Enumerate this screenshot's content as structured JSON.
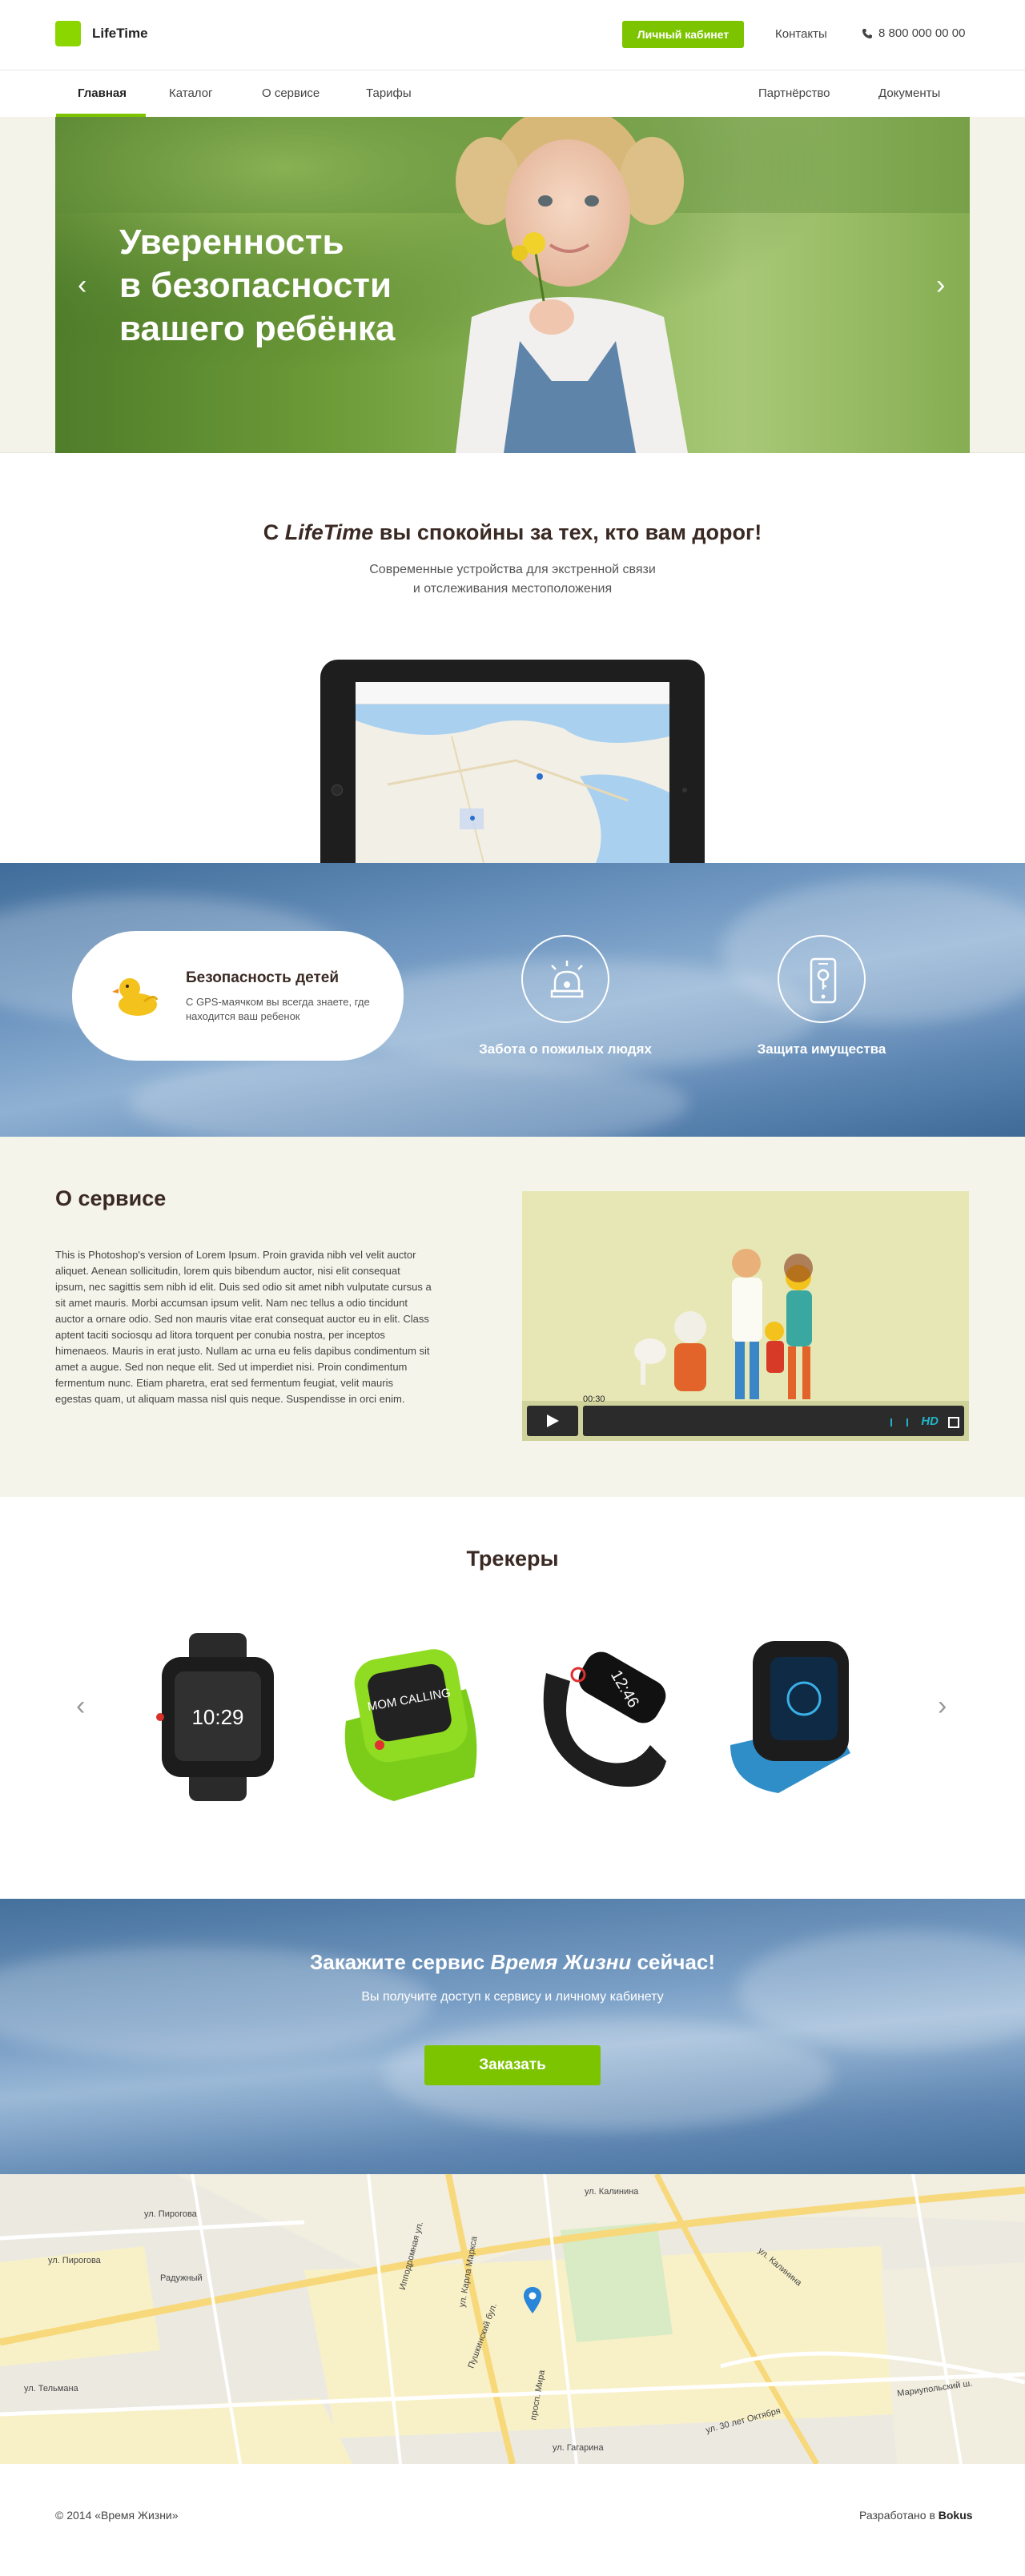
{
  "header": {
    "brand": "LifeTime",
    "cabinet_button": "Личный кабинет",
    "contacts": "Контакты",
    "phone": "8 800 000 00 00"
  },
  "nav": {
    "items": [
      {
        "label": "Главная",
        "active": true
      },
      {
        "label": "Каталог"
      },
      {
        "label": "О сервисе"
      },
      {
        "label": "Тарифы"
      },
      {
        "label": "Партнёрство"
      },
      {
        "label": "Документы"
      }
    ]
  },
  "hero": {
    "title_lines": [
      "Уверенность",
      "в безопасности",
      "вашего ребёнка"
    ],
    "prev_arrow": "‹",
    "next_arrow": "›"
  },
  "intro": {
    "title_prefix": "С ",
    "title_brand": "LifeTime",
    "title_suffix": " вы спокойны за тех, кто вам дорог!",
    "subtitle_lines": [
      "Современные устройства для экстренной связи",
      "и отслеживания местоположения"
    ]
  },
  "features": {
    "card_title": "Безопасность детей",
    "card_text": "С GPS-маячком вы всегда знаете, где находится ваш ребенок",
    "items": [
      {
        "label": "Забота о пожилых людях",
        "icon": "siren-icon"
      },
      {
        "label": "Защита имущества",
        "icon": "phone-key-icon"
      }
    ]
  },
  "about": {
    "title": "О сервисе",
    "text": "This is Photoshop's version of Lorem Ipsum. Proin gravida nibh vel velit auctor aliquet. Aenean sollicitudin, lorem quis bibendum auctor, nisi elit consequat ipsum, nec sagittis sem nibh id elit. Duis sed odio sit amet nibh vulputate cursus a sit amet mauris. Morbi accumsan ipsum velit. Nam nec tellus a odio tincidunt auctor a ornare odio. Sed non mauris vitae erat consequat auctor eu in elit. Class aptent taciti sociosqu ad litora torquent per conubia nostra, per inceptos himenaeos. Mauris in erat justo. Nullam ac urna eu felis dapibus condimentum sit amet a augue. Sed non neque elit. Sed ut imperdiet nisi. Proin condimentum fermentum nunc. Etiam pharetra, erat sed fermentum feugiat, velit mauris egestas quam, ut aliquam massa nisl quis neque. Suspendisse in orci enim.",
    "video_time": "00:30",
    "video_hd": "HD"
  },
  "trackers": {
    "title": "Трекеры",
    "items": [
      {
        "screen_text": "10:29"
      },
      {
        "screen_text": "MOM CALLING"
      },
      {
        "screen_text": "12:46"
      },
      {
        "screen_text": ""
      }
    ],
    "prev_arrow": "‹",
    "next_arrow": "›"
  },
  "cta": {
    "title_prefix": "Закажите сервис ",
    "title_brand": "Время Жизни",
    "title_suffix": " сейчас!",
    "subtitle": "Вы получите доступ к сервису и личному кабинету",
    "button": "Заказать"
  },
  "map": {
    "labels": [
      "ул. Пирогова",
      "ул. Пирогова",
      "Радужный",
      "ул. Калинина",
      "ул. Калинина",
      "ул. Карла Маркса",
      "Мариупольский ш.",
      "просп. Мира",
      "ул. Гагарина",
      "ул. 30 лет Октября",
      "ул. Тельмана",
      "Ипподромная ул.",
      "Пушкинский бул."
    ]
  },
  "footer": {
    "copyright": "© 2014 «Время Жизни»",
    "developed_prefix": "Разработано в ",
    "developer": "Bokus"
  }
}
